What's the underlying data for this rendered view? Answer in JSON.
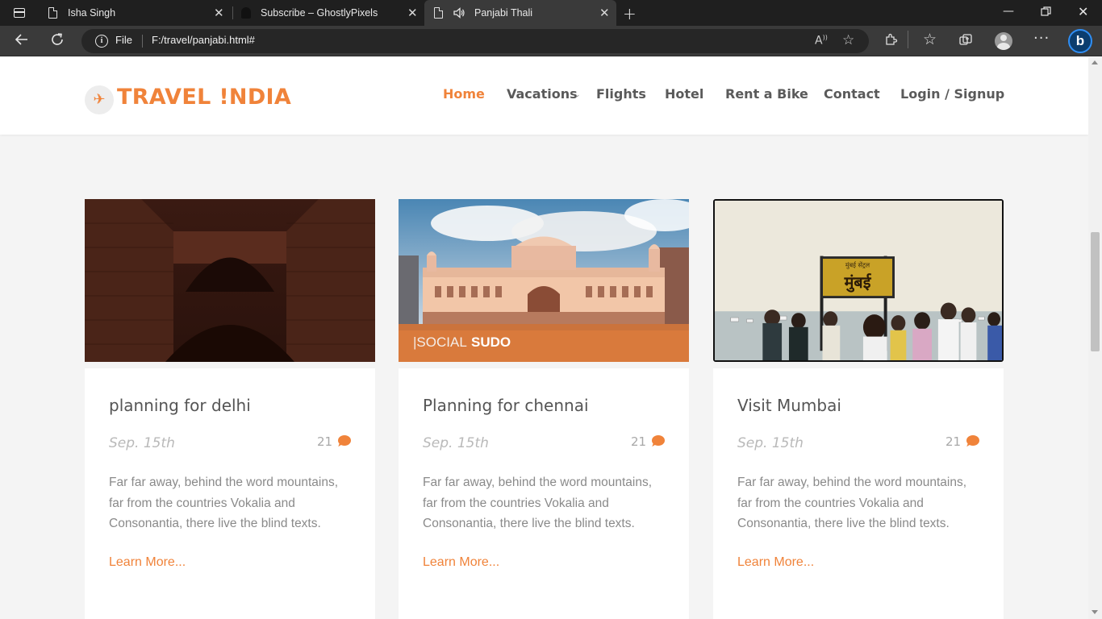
{
  "browser": {
    "tabs": [
      {
        "title": "Isha Singh",
        "icon": "page-icon"
      },
      {
        "title": "Subscribe – GhostlyPixels",
        "icon": "ghost-icon"
      },
      {
        "title": "Panjabi Thali",
        "icon": "page-icon",
        "audio": "speaker-icon",
        "active": true
      }
    ],
    "address": {
      "scheme_label": "File",
      "url": "F:/travel/panjabi.html#"
    }
  },
  "site": {
    "logo": "TRAVEL !NDIA",
    "nav": {
      "home": "Home",
      "vacations": "Vacations",
      "flights": "Flights",
      "hotel": "Hotel",
      "rent_bike": "Rent a Bike",
      "contact": "Contact",
      "login": "Login / Signup"
    },
    "accent_color": "#f0833a"
  },
  "cards": [
    {
      "title": "planning for delhi",
      "date": "Sep. 15th",
      "comments": "21",
      "text": "Far far away, behind the word mountains, far from the countries Vokalia and Consonantia, there live the blind texts.",
      "link": "Learn More..."
    },
    {
      "title": "Planning for chennai",
      "date": "Sep. 15th",
      "comments": "21",
      "text": "Far far away, behind the word mountains, far from the countries Vokalia and Consonantia, there live the blind texts.",
      "link": "Learn More...",
      "image_watermark": {
        "left": "|SOCIAL",
        "right": "SUDO"
      }
    },
    {
      "title": "Visit Mumbai",
      "date": "Sep. 15th",
      "comments": "21",
      "text": "Far far away, behind the word mountains, far from the countries Vokalia and Consonantia, there live the blind texts.",
      "link": "Learn More...",
      "image_sign": {
        "top": "मुंबई सेंट्रल",
        "main": "मुंबई"
      }
    }
  ]
}
